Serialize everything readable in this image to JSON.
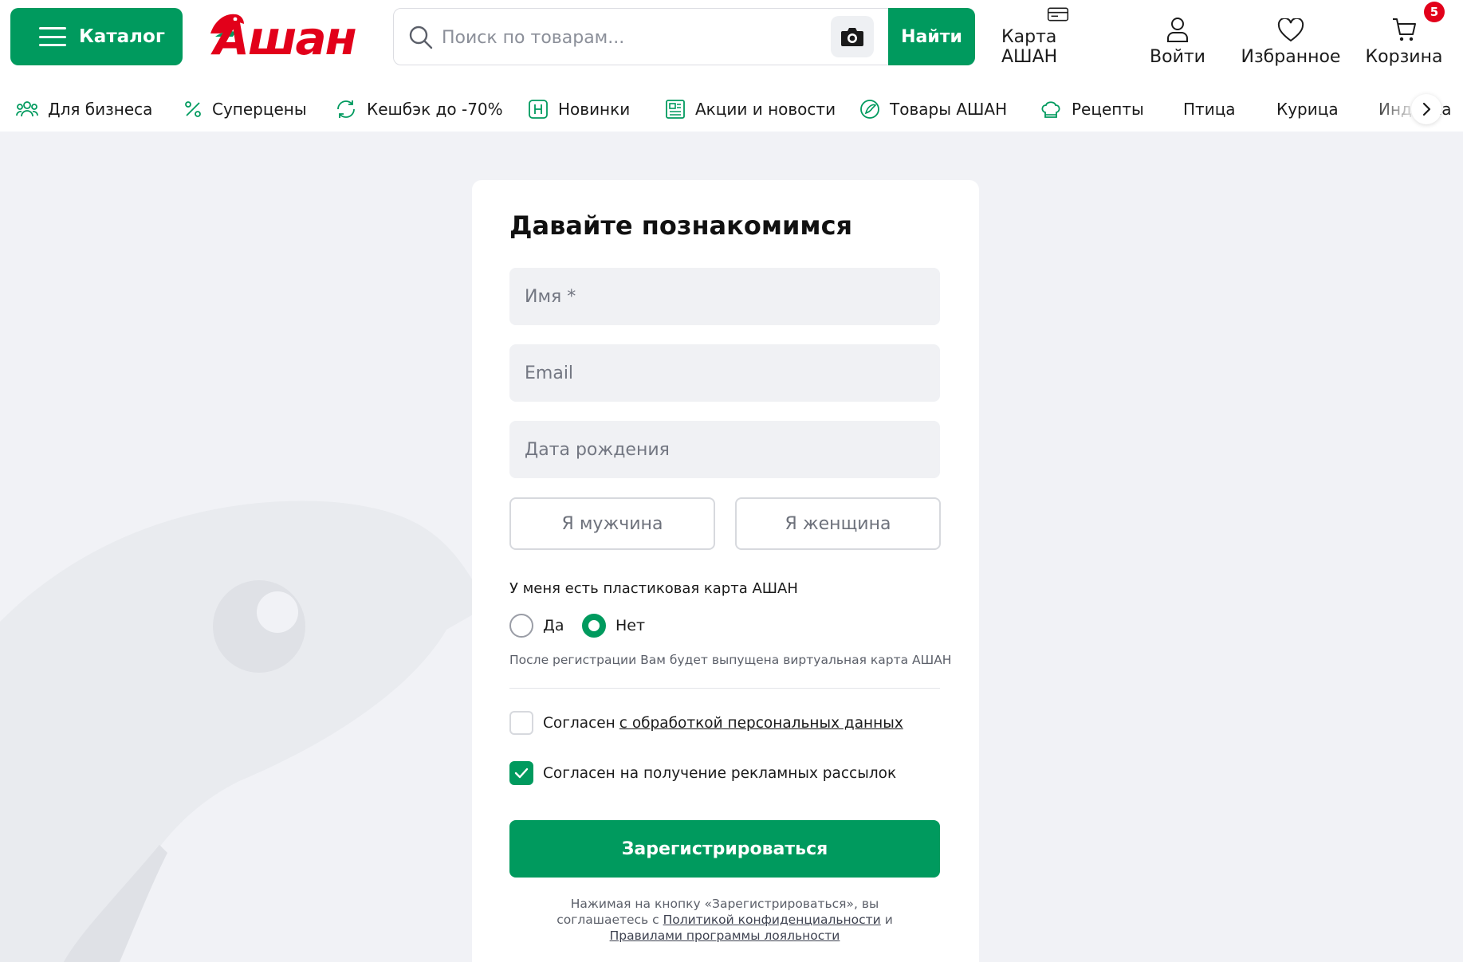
{
  "header": {
    "catalog_label": "Каталог",
    "logo_text": "Ашан",
    "search_placeholder": "Поиск по товарам...",
    "search_value": "",
    "find_label": "Найти",
    "actions": {
      "card": "Карта АШАН",
      "login": "Войти",
      "favorites": "Избранное",
      "cart": "Корзина",
      "cart_count": "5"
    }
  },
  "nav": {
    "items": [
      {
        "label": "Для бизнеса",
        "icon": "people-icon"
      },
      {
        "label": "Суперцены",
        "icon": "percent-icon"
      },
      {
        "label": "Кешбэк до -70%",
        "icon": "refresh-icon"
      },
      {
        "label": "Новинки",
        "icon": "new-badge-icon"
      },
      {
        "label": "Акции и новости",
        "icon": "news-icon"
      },
      {
        "label": "Товары АШАН",
        "icon": "brand-icon"
      },
      {
        "label": "Рецепты",
        "icon": "chef-hat-icon"
      },
      {
        "label": "Птица",
        "icon": ""
      },
      {
        "label": "Курица",
        "icon": ""
      },
      {
        "label": "Индейка",
        "icon": ""
      }
    ]
  },
  "form": {
    "title": "Давайте познакомимся",
    "name_placeholder": "Имя *",
    "email_placeholder": "Email",
    "birth_placeholder": "Дата рождения",
    "male_label": "Я мужчина",
    "female_label": "Я женщина",
    "card_question": "У меня есть пластиковая карта АШАН",
    "yes_label": "Да",
    "no_label": "Нет",
    "selected_card_option": "Нет",
    "card_hint": "После регистрации Вам будет выпущена виртуальная карта АШАН",
    "consent_pd_prefix": "Согласен",
    "consent_pd_link": "с обработкой персональных данных",
    "consent_pd_checked": false,
    "consent_ads": "Согласен на получение рекламных рассылок",
    "consent_ads_checked": true,
    "submit_label": "Зарегистрироваться",
    "legal_line1": "Нажимая на кнопку «Зарегистрироваться», вы",
    "legal_line2_prefix": "соглашаетесь с",
    "legal_privacy_link": "Политикой конфиденциальности",
    "legal_and": "и",
    "legal_loyalty_link": "Правилами программы лояльности"
  },
  "colors": {
    "brand_green": "#009a5e",
    "brand_red": "#e2001a",
    "page_bg": "#f1f2f6"
  }
}
